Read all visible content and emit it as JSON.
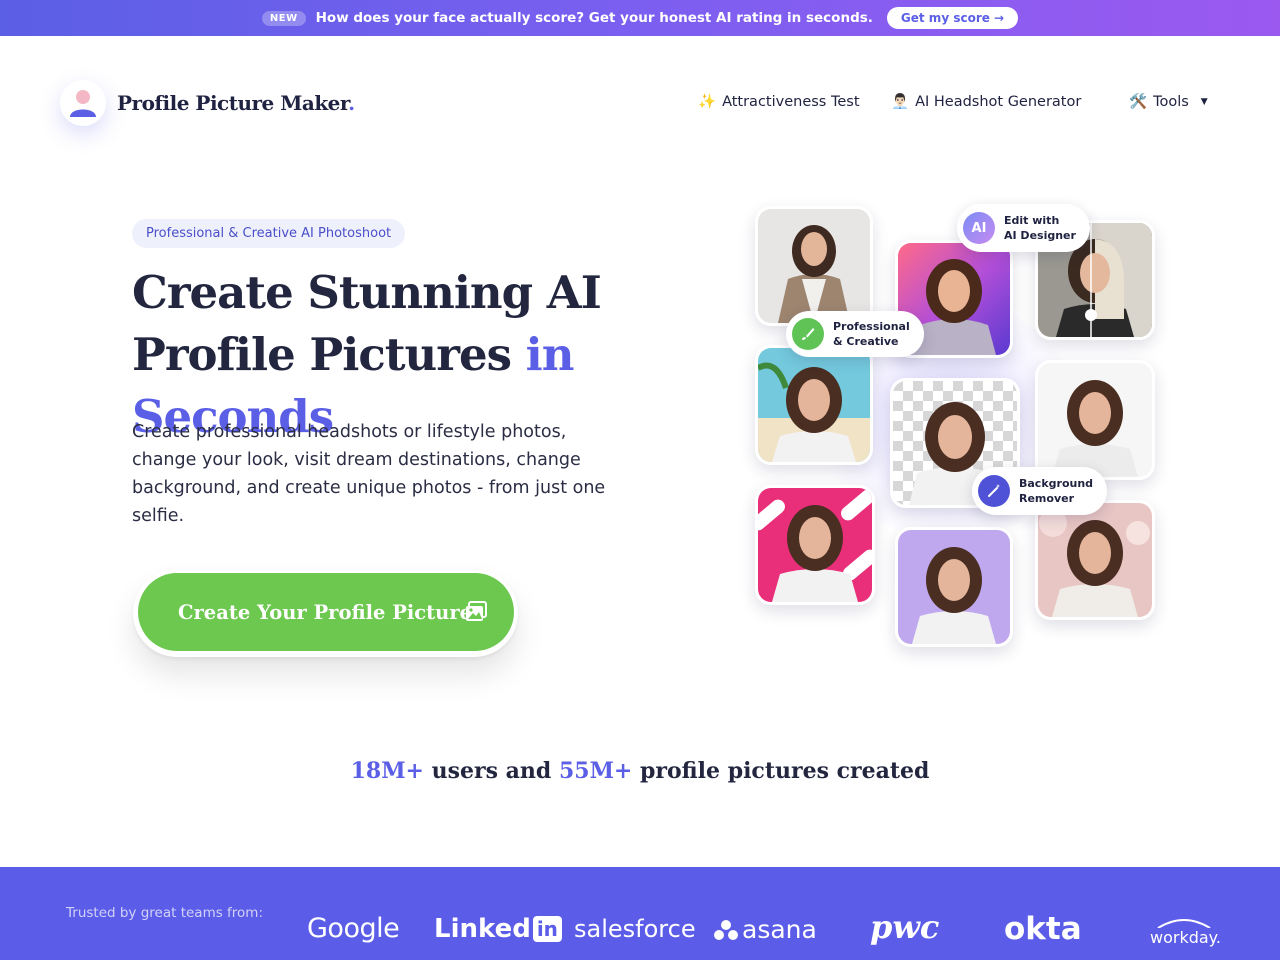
{
  "announcement": {
    "badge": "NEW",
    "message": "How does your face actually score? Get your honest AI rating in seconds.",
    "cta": "Get my score →"
  },
  "header": {
    "logo_text": "Profile Picture Maker",
    "logo_dot": ".",
    "nav": [
      {
        "emoji": "✨",
        "label": "Attractiveness Test"
      },
      {
        "emoji": "👨🏻‍💼",
        "label": "AI Headshot Generator"
      },
      {
        "emoji": "🛠️",
        "label": "Tools"
      }
    ]
  },
  "hero": {
    "pill": "Professional & Creative AI Photoshoot",
    "headline_part1": "Create Stunning AI Profile Pictures ",
    "headline_accent": "in Seconds",
    "subtitle": "Create professional headshots or lifestyle photos, change your look, visit dream destinations, change background, and create unique photos - from just one selfie.",
    "cta": "Create Your Profile Picture"
  },
  "collage": {
    "chips": {
      "ai_designer": {
        "icon": "AI",
        "label": "Edit with\nAI Designer"
      },
      "pro_creative": {
        "label": "Professional\n& Creative"
      },
      "bg_remover": {
        "label": "Background\nRemover"
      }
    }
  },
  "stats": {
    "users": "18M+",
    "users_text": " users and ",
    "pictures": "55M+",
    "pictures_text": " profile pictures created"
  },
  "trusted": {
    "label": "Trusted by great teams from:",
    "brands": [
      "Google",
      "Linked",
      "in",
      "salesforce",
      "asana",
      "pwc",
      "okta",
      "workday."
    ]
  },
  "colors": {
    "accent": "#5b5fe6",
    "cta_green": "#6cc84f",
    "band": "#5b5ce8"
  }
}
